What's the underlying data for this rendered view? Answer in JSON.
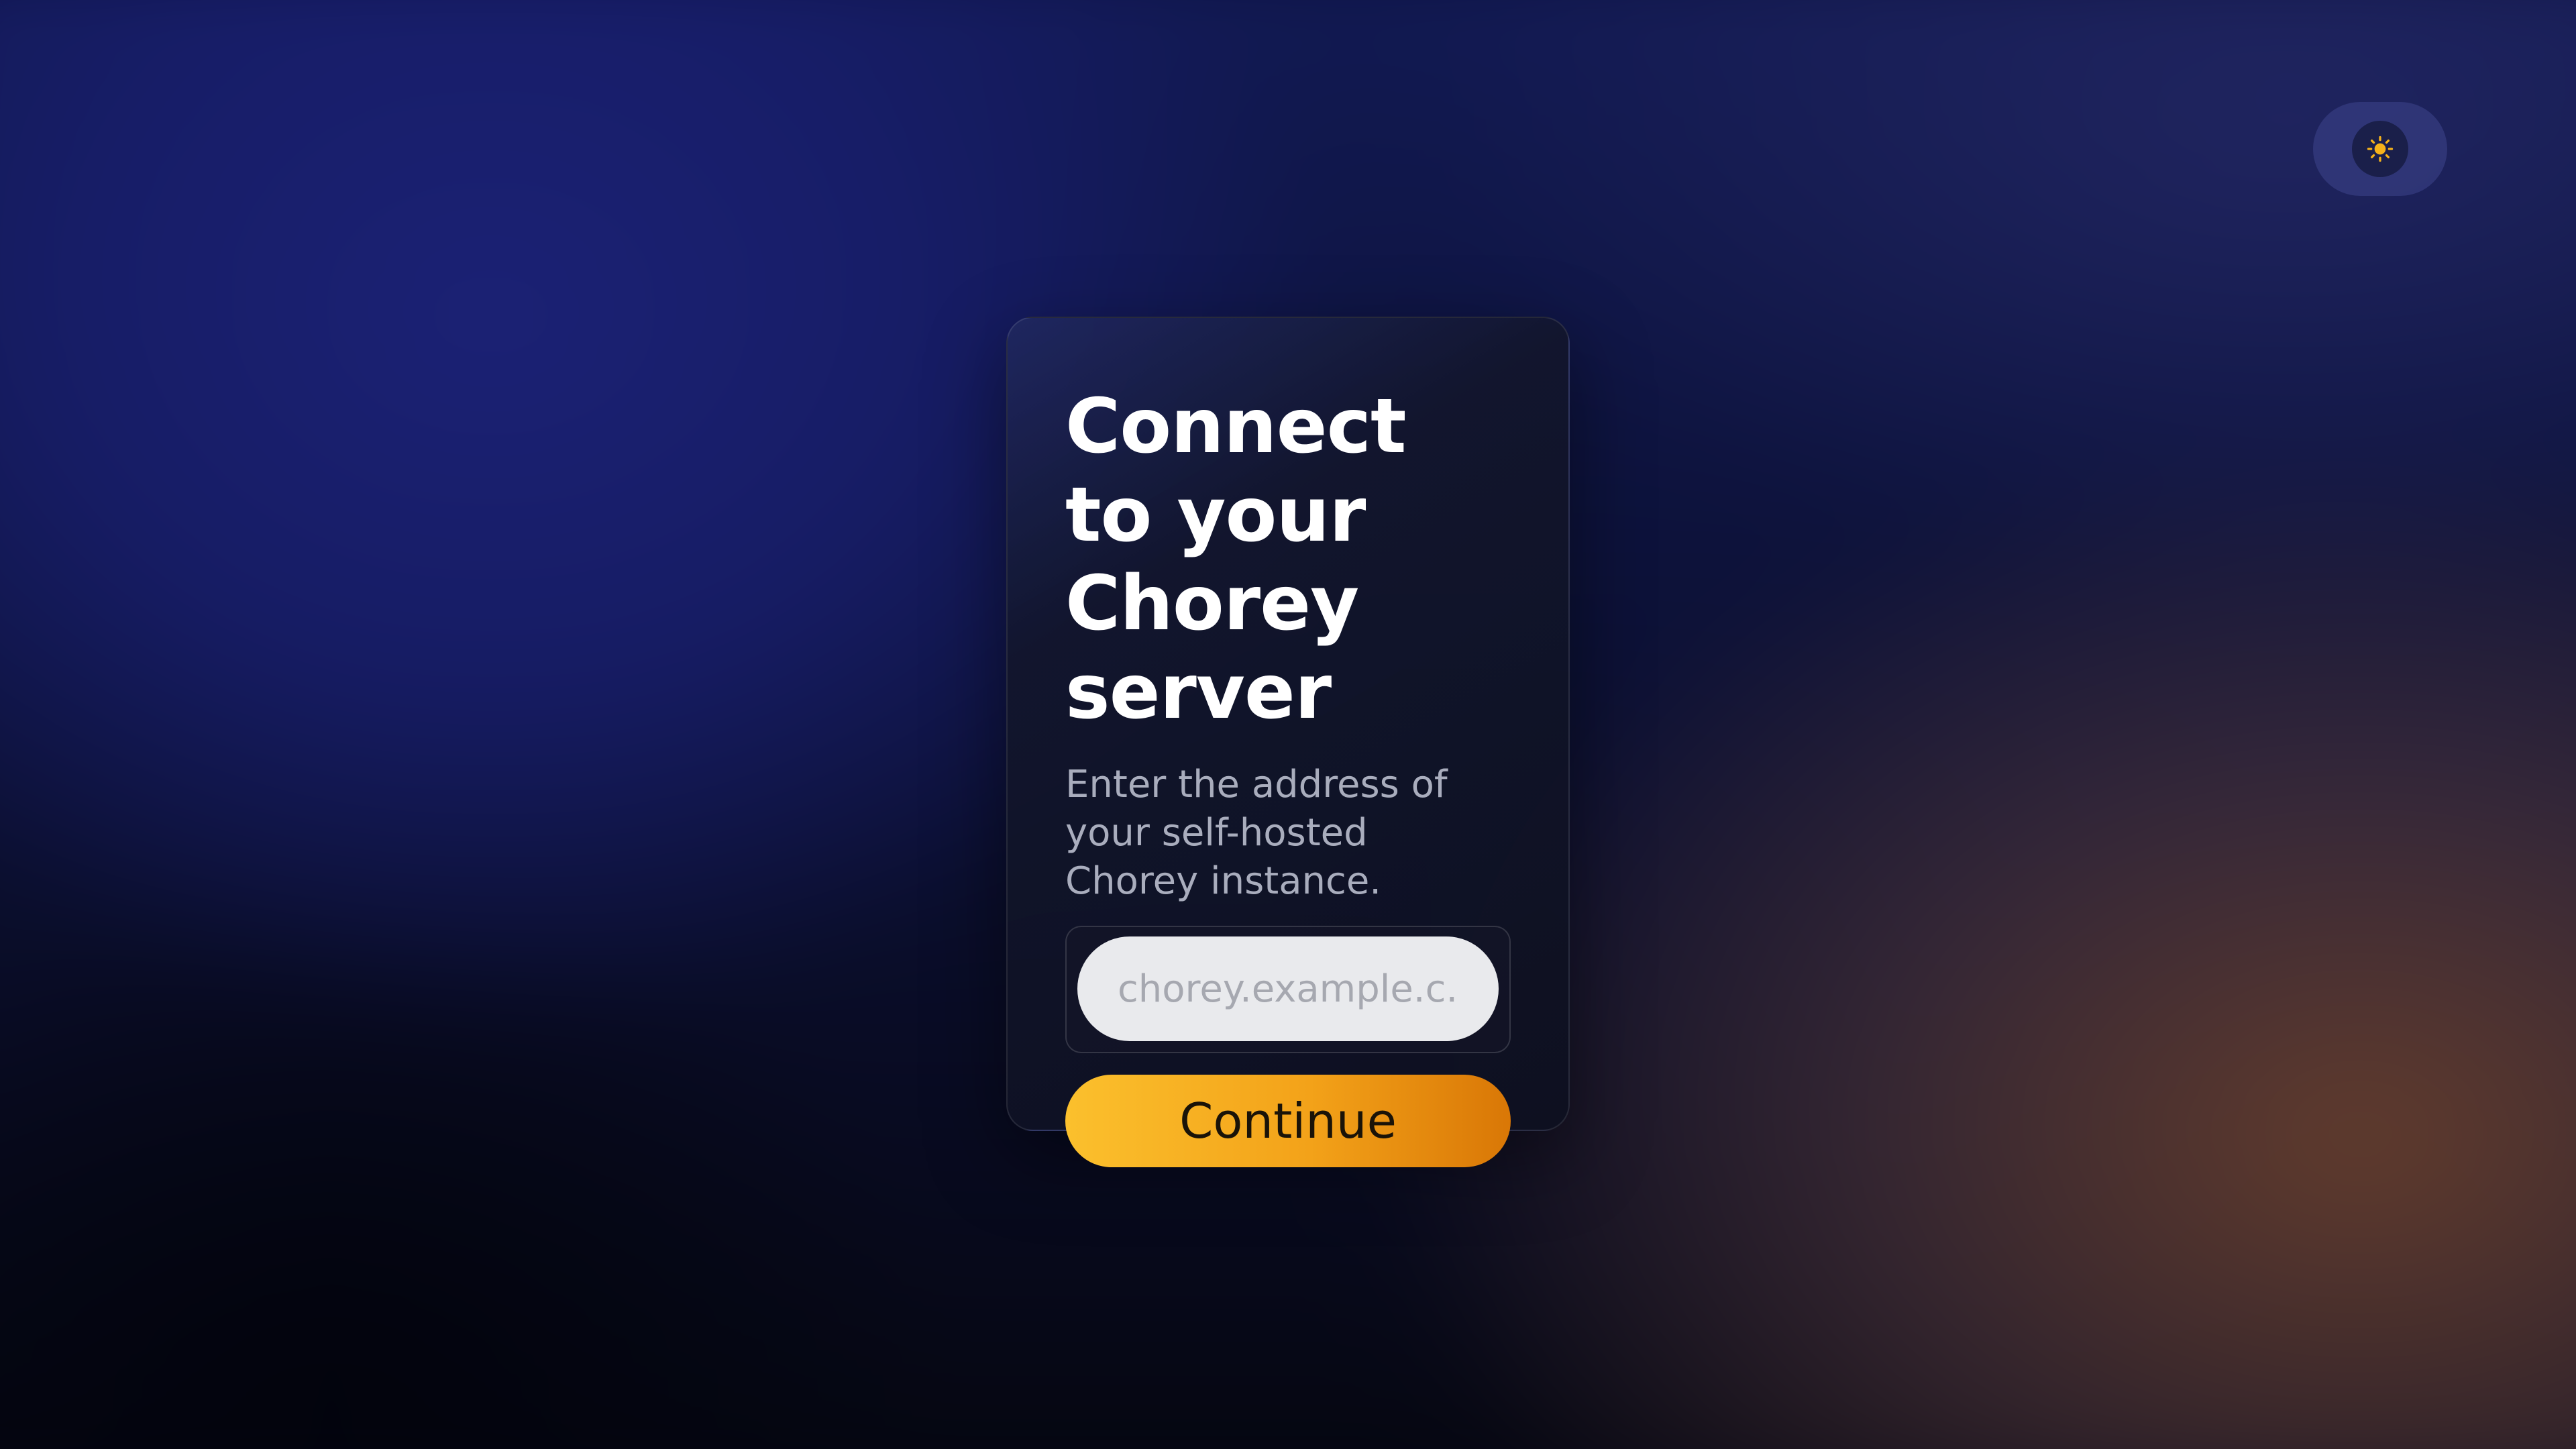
{
  "theme_toggle": {
    "icon": "sun-icon",
    "icon_color": "#f5b21a"
  },
  "card": {
    "title": "Connect to your Chorey server",
    "subtitle": "Enter the address of your self-hosted Chorey instance.",
    "server_input": {
      "placeholder": "chorey.example.c...",
      "value": ""
    },
    "continue_label": "Continue"
  },
  "colors": {
    "accent_start": "#fbc02d",
    "accent_end": "#d97706",
    "card_background": "#12162c"
  }
}
